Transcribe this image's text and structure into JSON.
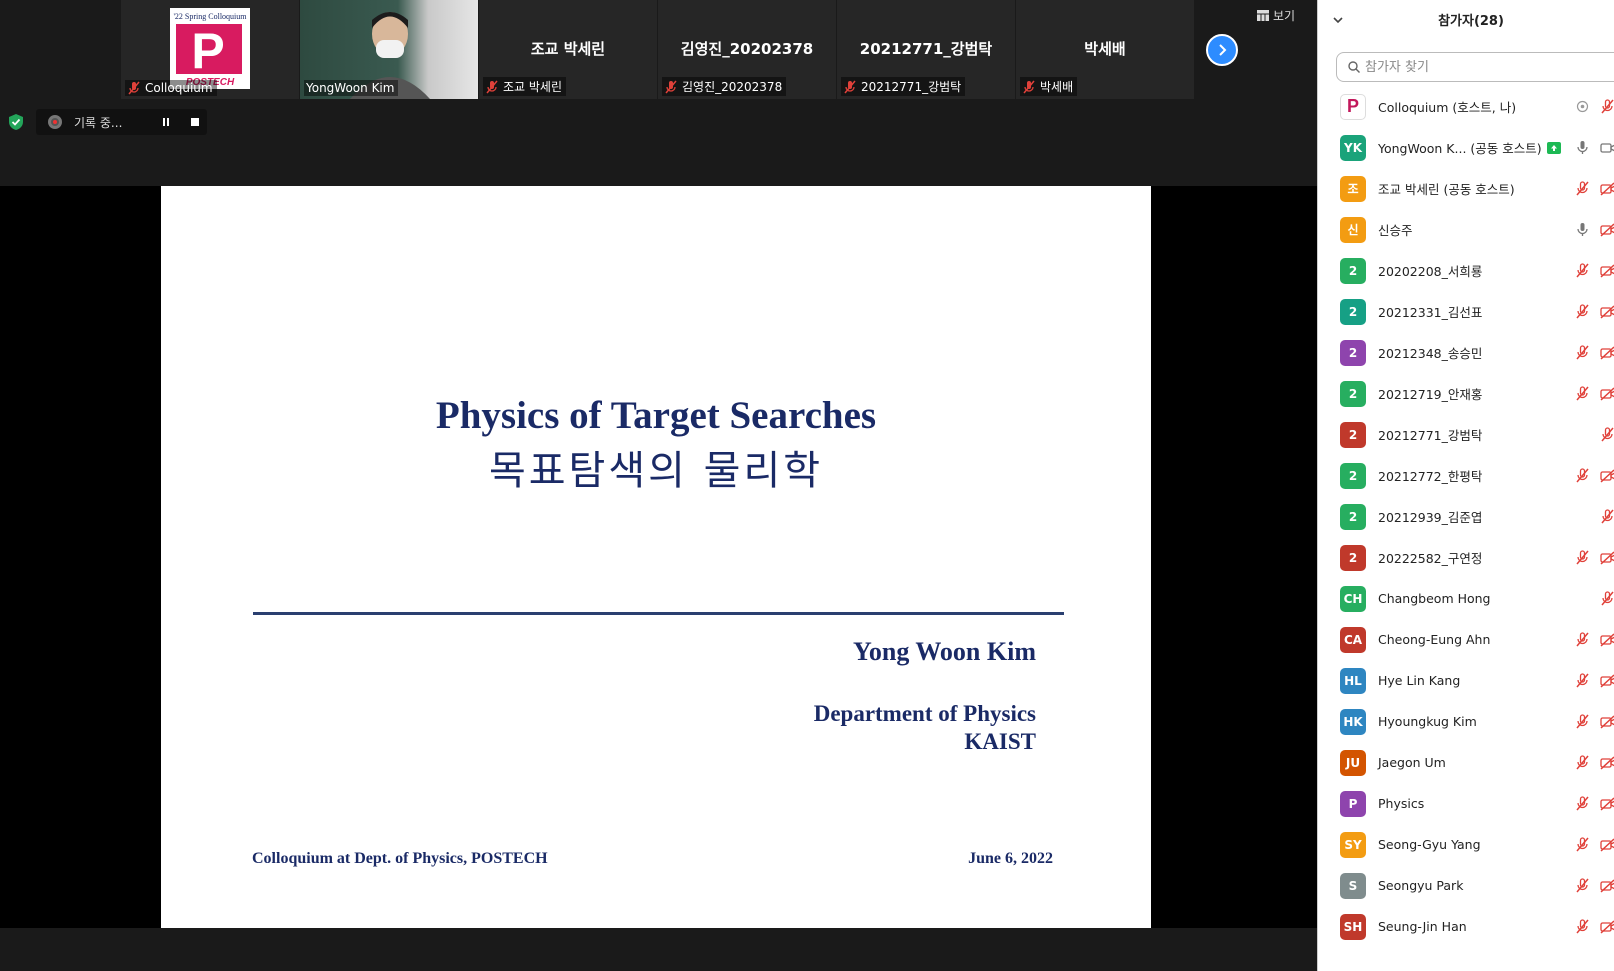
{
  "video_strip": {
    "tiles": [
      {
        "label": "Colloquium",
        "center": ""
      },
      {
        "label": "YongWoon Kim",
        "center": ""
      },
      {
        "label": "조교 박세린",
        "center": "조교 박세린"
      },
      {
        "label": "김영진_20202378",
        "center": "김영진_20202378"
      },
      {
        "label": "20212771_강범탁",
        "center": "20212771_강범탁"
      },
      {
        "label": "박세배",
        "center": "박세배"
      }
    ],
    "logo_text": "'22 Spring Colloquium",
    "logo_letter": "P",
    "logo_brand": "POSTECH",
    "view_label": "보기"
  },
  "recording": {
    "label": "기록 중..."
  },
  "slide": {
    "title": "Physics of Target Searches",
    "subtitle": "목표탐색의 물리학",
    "author": "Yong Woon Kim",
    "dept_line1": "Department of Physics",
    "dept_line2": "KAIST",
    "footer_left": "Colloquium at Dept. of Physics, POSTECH",
    "footer_right": "June 6, 2022"
  },
  "panel": {
    "title": "참가자(28)",
    "search_placeholder": "참가자 찾기",
    "participants": [
      {
        "initials": "P",
        "name": "Colloquium (호스트, 나)",
        "color": "#c2185b",
        "logo": true
      },
      {
        "initials": "YK",
        "name": "YongWoon K... (공동 호스트)",
        "color": "#1aa37a",
        "badge": true
      },
      {
        "initials": "조",
        "name": "조교 박세린 (공동 호스트)",
        "color": "#f39c12"
      },
      {
        "initials": "신",
        "name": "신승주",
        "color": "#f39c12"
      },
      {
        "initials": "2",
        "name": "20202208_서희룡",
        "color": "#27ae60"
      },
      {
        "initials": "2",
        "name": "20212331_김선표",
        "color": "#16a085"
      },
      {
        "initials": "2",
        "name": "20212348_송승민",
        "color": "#8e44ad"
      },
      {
        "initials": "2",
        "name": "20212719_안재홍",
        "color": "#27ae60"
      },
      {
        "initials": "2",
        "name": "20212771_강범탁",
        "color": "#c0392b"
      },
      {
        "initials": "2",
        "name": "20212772_한평탁",
        "color": "#27ae60"
      },
      {
        "initials": "2",
        "name": "20212939_김준엽",
        "color": "#27ae60"
      },
      {
        "initials": "2",
        "name": "20222582_구연정",
        "color": "#c0392b"
      },
      {
        "initials": "CH",
        "name": "Changbeom Hong",
        "color": "#27ae60"
      },
      {
        "initials": "CA",
        "name": "Cheong-Eung Ahn",
        "color": "#c0392b"
      },
      {
        "initials": "HL",
        "name": "Hye Lin Kang",
        "color": "#2e86c1"
      },
      {
        "initials": "HK",
        "name": "Hyoungkug Kim",
        "color": "#2e86c1"
      },
      {
        "initials": "JU",
        "name": "Jaegon Um",
        "color": "#d35400"
      },
      {
        "initials": "P",
        "name": "Physics",
        "color": "#8e44ad"
      },
      {
        "initials": "SY",
        "name": "Seong-Gyu Yang",
        "color": "#f39c12"
      },
      {
        "initials": "S",
        "name": "Seongyu Park",
        "color": "#7f8c8d"
      },
      {
        "initials": "SH",
        "name": "Seung-Jin Han",
        "color": "#c0392b"
      }
    ]
  },
  "colors": {
    "accent": "#2d8cff",
    "speaking": "#b5e04f",
    "slide_text": "#1a2a66"
  }
}
